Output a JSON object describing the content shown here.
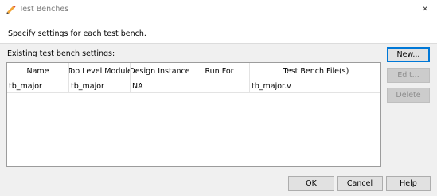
{
  "window": {
    "title": "Test Benches",
    "close_symbol": "✕"
  },
  "instructions": "Specify settings for each test bench.",
  "section_label": "Existing test bench settings:",
  "table": {
    "columns": [
      "Name",
      "Top Level Module",
      "Design Instance",
      "Run For",
      "Test Bench File(s)"
    ],
    "rows": [
      [
        "tb_major",
        "tb_major",
        "NA",
        "",
        "tb_major.v"
      ]
    ]
  },
  "side_buttons": {
    "new_label": "New...",
    "edit_label": "Edit...",
    "delete_label": "Delete"
  },
  "footer_buttons": {
    "ok_label": "OK",
    "cancel_label": "Cancel",
    "help_label": "Help"
  },
  "icons": {
    "title_icon": "pencil-icon",
    "close_icon": "close-icon"
  },
  "colors": {
    "primary_button_border": "#0078d7",
    "disabled_text": "#8d8d8d"
  }
}
